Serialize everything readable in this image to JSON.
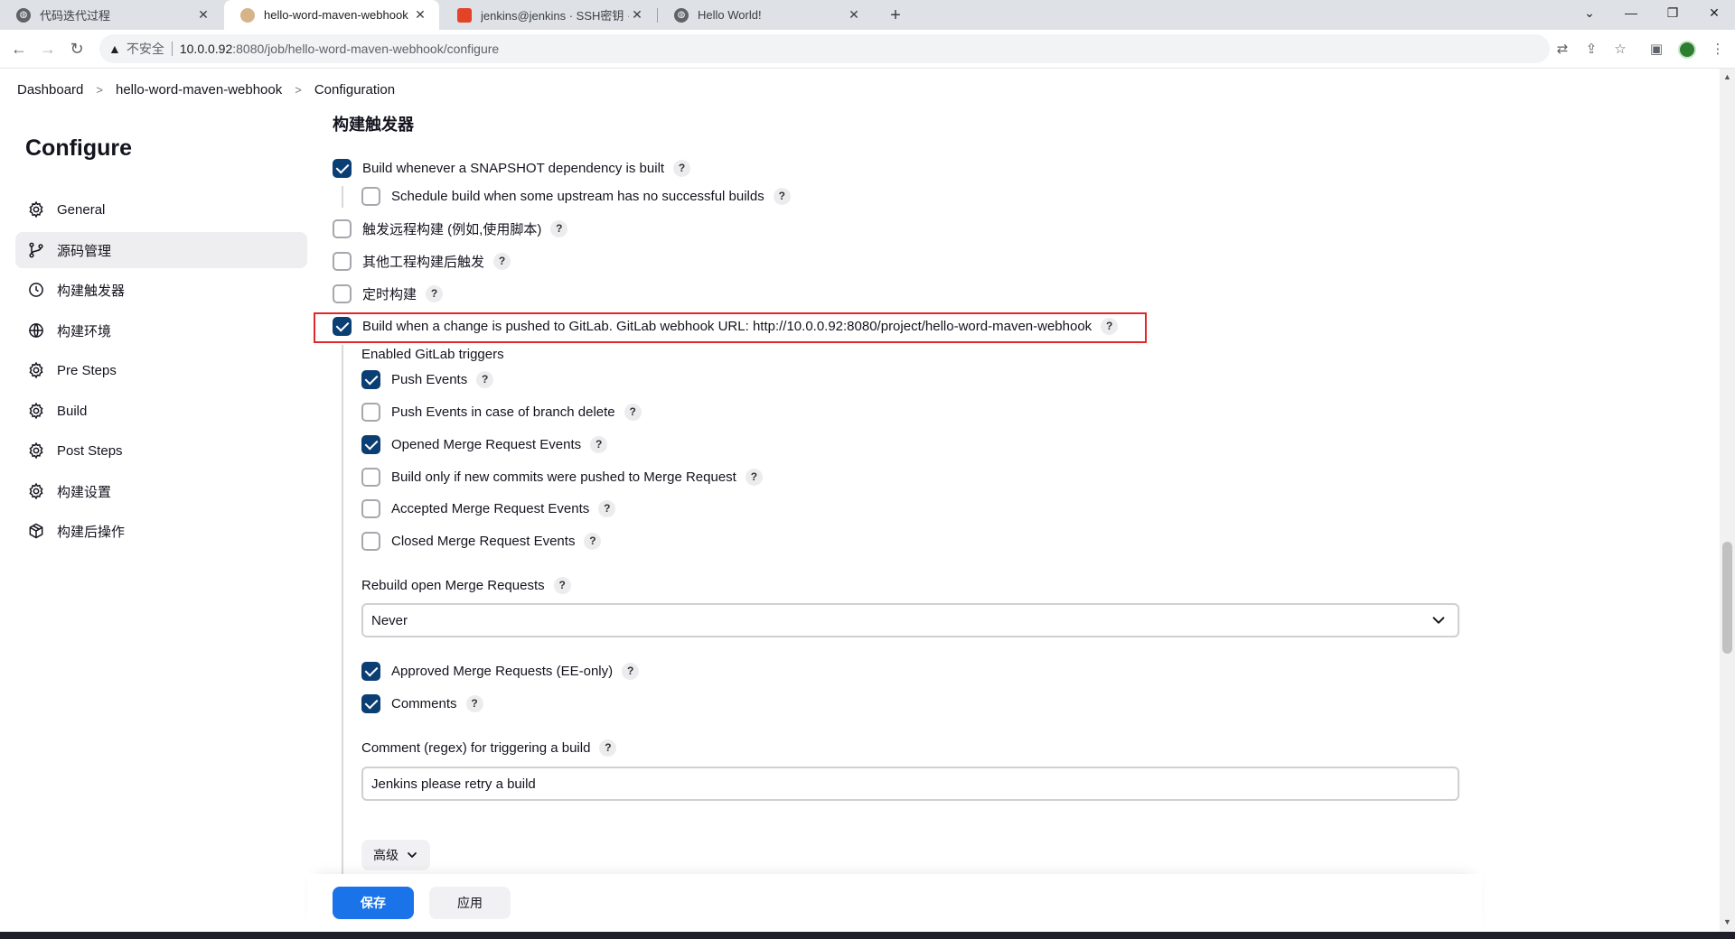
{
  "browser": {
    "tabs": [
      {
        "title": "代码迭代过程",
        "icon": "globe-icon"
      },
      {
        "title": "hello-word-maven-webhook C",
        "icon": "jenkins-icon"
      },
      {
        "title": "jenkins@jenkins · SSH密钥 · 用",
        "icon": "gitlab-icon"
      },
      {
        "title": "Hello World!",
        "icon": "globe-icon"
      }
    ],
    "insecure_label": "不安全",
    "url_host": "10.0.0.92",
    "url_path": ":8080/job/hello-word-maven-webhook/configure"
  },
  "breadcrumbs": [
    "Dashboard",
    "hello-word-maven-webhook",
    "Configuration"
  ],
  "sidebar": {
    "title": "Configure",
    "items": [
      {
        "label": "General",
        "icon": "gear-icon"
      },
      {
        "label": "源码管理",
        "icon": "branch-icon"
      },
      {
        "label": "构建触发器",
        "icon": "clock-icon"
      },
      {
        "label": "构建环境",
        "icon": "globe-icon"
      },
      {
        "label": "Pre Steps",
        "icon": "gear-icon"
      },
      {
        "label": "Build",
        "icon": "gear-icon"
      },
      {
        "label": "Post Steps",
        "icon": "gear-icon"
      },
      {
        "label": "构建设置",
        "icon": "gear-icon"
      },
      {
        "label": "构建后操作",
        "icon": "package-icon"
      }
    ],
    "active_index": 1
  },
  "section_title": "构建触发器",
  "triggers": {
    "snapshot": {
      "label": "Build whenever a SNAPSHOT dependency is built",
      "checked": true
    },
    "upstream": {
      "label": "Schedule build when some upstream has no successful builds",
      "checked": false
    },
    "remote": {
      "label": "触发远程构建 (例如,使用脚本)",
      "checked": false
    },
    "after_other": {
      "label": "其他工程构建后触发",
      "checked": false
    },
    "timer": {
      "label": "定时构建",
      "checked": false
    },
    "gitlab": {
      "label": "Build when a change is pushed to GitLab. GitLab webhook URL: http://10.0.0.92:8080/project/hello-word-maven-webhook",
      "checked": true
    }
  },
  "gitlab": {
    "enabled_triggers_label": "Enabled GitLab triggers",
    "push_events": {
      "label": "Push Events",
      "checked": true
    },
    "push_branch_delete": {
      "label": "Push Events in case of branch delete",
      "checked": false
    },
    "opened_mr": {
      "label": "Opened Merge Request Events",
      "checked": true
    },
    "new_commits_mr": {
      "label": "Build only if new commits were pushed to Merge Request",
      "checked": false
    },
    "accepted_mr": {
      "label": "Accepted Merge Request Events",
      "checked": false
    },
    "closed_mr": {
      "label": "Closed Merge Request Events",
      "checked": false
    },
    "rebuild_label": "Rebuild open Merge Requests",
    "rebuild_value": "Never",
    "approved_mr": {
      "label": "Approved Merge Requests (EE-only)",
      "checked": true
    },
    "comments": {
      "label": "Comments",
      "checked": true
    },
    "comment_regex_label": "Comment (regex) for triggering a build",
    "comment_regex_value": "Jenkins please retry a build",
    "advanced_label": "高级"
  },
  "help_glyph": "?",
  "footer": {
    "save_label": "保存",
    "apply_label": "应用"
  },
  "colors": {
    "accent": "#1a73e8",
    "checkbox": "#0b3e73",
    "highlight": "#e0272b"
  }
}
